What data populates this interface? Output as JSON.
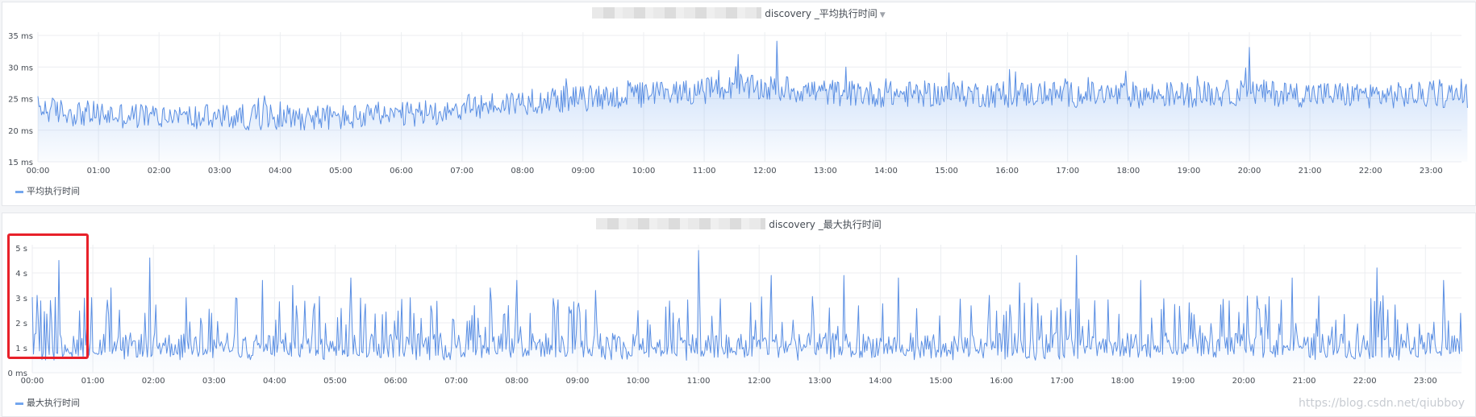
{
  "colors": {
    "line": "#5b8fe3",
    "fill": "#73a6ee",
    "grid": "#eceef1",
    "highlight": "#e8212a"
  },
  "panels": [
    {
      "title": "discovery _平均执行时间",
      "legend": "平均执行时间"
    },
    {
      "title": "discovery _最大执行时间",
      "legend": "最大执行时间"
    }
  ],
  "watermark": "https://blog.csdn.net/qiubboy",
  "chart_data": [
    {
      "type": "area",
      "title": "discovery _平均执行时间",
      "xlabel": "",
      "ylabel": "",
      "x_ticks": [
        "00:00",
        "01:00",
        "02:00",
        "03:00",
        "04:00",
        "05:00",
        "06:00",
        "07:00",
        "08:00",
        "09:00",
        "10:00",
        "11:00",
        "12:00",
        "13:00",
        "14:00",
        "15:00",
        "16:00",
        "17:00",
        "18:00",
        "19:00",
        "20:00",
        "21:00",
        "22:00",
        "23:00"
      ],
      "y_ticks": [
        "15 ms",
        "20 ms",
        "25 ms",
        "30 ms",
        "35 ms"
      ],
      "ylim": [
        15,
        35
      ],
      "x_range_hours": [
        0,
        23.6
      ],
      "grid": true,
      "legend_position": "bottom-left",
      "series": [
        {
          "name": "平均执行时间",
          "x_hours": [
            0,
            0.5,
            1,
            1.5,
            2,
            2.5,
            3,
            3.5,
            4,
            4.5,
            5,
            5.5,
            6,
            6.5,
            7,
            7.5,
            8,
            8.5,
            9,
            9.5,
            10,
            10.5,
            11,
            11.5,
            12,
            12.5,
            13,
            13.5,
            14,
            14.5,
            15,
            15.5,
            16,
            16.5,
            17,
            17.5,
            18,
            18.5,
            19,
            19.5,
            20,
            20.5,
            21,
            21.5,
            22,
            22.5,
            23,
            23.5
          ],
          "values": [
            23.5,
            22.8,
            22.5,
            22.3,
            22.2,
            22.0,
            22.0,
            22.1,
            22.2,
            22.1,
            22.0,
            22.1,
            22.3,
            22.8,
            23.5,
            24.0,
            24.5,
            24.8,
            25.0,
            25.3,
            25.6,
            26.0,
            26.3,
            26.6,
            26.6,
            26.4,
            26.0,
            25.8,
            25.7,
            25.7,
            25.8,
            25.7,
            25.6,
            25.8,
            25.7,
            25.6,
            25.6,
            25.6,
            25.7,
            25.8,
            26.0,
            25.8,
            25.7,
            25.6,
            25.6,
            25.5,
            25.6,
            25.6
          ],
          "peaks": [
            {
              "x": 12.2,
              "y": 34.1
            },
            {
              "x": 20.0,
              "y": 33.1
            },
            {
              "x": 11.55,
              "y": 32.0
            }
          ]
        }
      ]
    },
    {
      "type": "line",
      "title": "discovery _最大执行时间",
      "xlabel": "",
      "ylabel": "",
      "x_ticks": [
        "00:00",
        "01:00",
        "02:00",
        "03:00",
        "04:00",
        "05:00",
        "06:00",
        "07:00",
        "08:00",
        "09:00",
        "10:00",
        "11:00",
        "12:00",
        "13:00",
        "14:00",
        "15:00",
        "16:00",
        "17:00",
        "18:00",
        "19:00",
        "20:00",
        "21:00",
        "22:00",
        "23:00"
      ],
      "y_ticks": [
        "0 ms",
        "1 s",
        "2 s",
        "3 s",
        "4 s",
        "5 s"
      ],
      "ylim": [
        0,
        5
      ],
      "x_range_hours": [
        0,
        23.6
      ],
      "grid": true,
      "legend_position": "bottom-left",
      "series": [
        {
          "name": "最大执行时间",
          "baseline_s": 1.1,
          "spikes": [
            {
              "x": 0.07,
              "y": 3.1
            },
            {
              "x": 0.45,
              "y": 4.5
            },
            {
              "x": 1.3,
              "y": 3.4
            },
            {
              "x": 1.95,
              "y": 4.6
            },
            {
              "x": 3.8,
              "y": 3.7
            },
            {
              "x": 4.3,
              "y": 3.5
            },
            {
              "x": 5.25,
              "y": 3.8
            },
            {
              "x": 7.55,
              "y": 3.4
            },
            {
              "x": 8.0,
              "y": 3.7
            },
            {
              "x": 9.3,
              "y": 3.3
            },
            {
              "x": 11.0,
              "y": 4.9
            },
            {
              "x": 12.2,
              "y": 3.9
            },
            {
              "x": 13.4,
              "y": 3.9
            },
            {
              "x": 14.3,
              "y": 3.8
            },
            {
              "x": 16.3,
              "y": 3.6
            },
            {
              "x": 17.25,
              "y": 4.7
            },
            {
              "x": 18.3,
              "y": 3.7
            },
            {
              "x": 20.8,
              "y": 3.8
            },
            {
              "x": 22.2,
              "y": 4.2
            },
            {
              "x": 23.3,
              "y": 3.7
            }
          ]
        }
      ]
    }
  ]
}
